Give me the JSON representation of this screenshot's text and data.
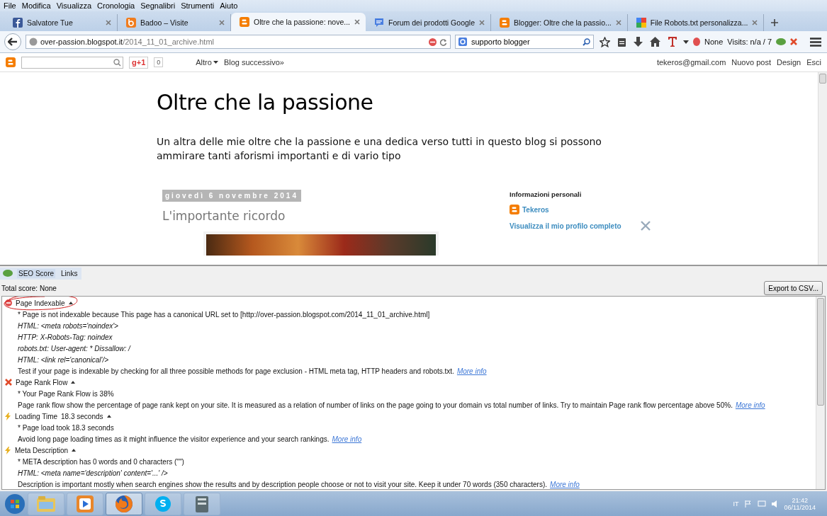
{
  "menu": [
    "File",
    "Modifica",
    "Visualizza",
    "Cronologia",
    "Segnalibri",
    "Strumenti",
    "Aiuto"
  ],
  "tabs": [
    {
      "title": "Salvatore Tue",
      "kind": "facebook",
      "selected": false
    },
    {
      "title": "Badoo – Visite",
      "kind": "badoo",
      "selected": false
    },
    {
      "title": "Oltre che la passione: nove...",
      "kind": "blogger",
      "selected": true
    },
    {
      "title": "Forum dei prodotti Google",
      "kind": "forum",
      "selected": false
    },
    {
      "title": "Blogger: Oltre che la passio...",
      "kind": "blogger",
      "selected": false
    },
    {
      "title": "File Robots.txt personalizza...",
      "kind": "google",
      "selected": false
    }
  ],
  "address": {
    "host": "over-passion.blogspot.it",
    "path": "/2014_11_01_archive.html"
  },
  "search": {
    "value": "supporto blogger"
  },
  "toolbar": {
    "seo_status": "None",
    "visits": "Visits: n/a / 7"
  },
  "blogger_bar": {
    "plus_one": "g+1",
    "count": "0",
    "more": "Altro",
    "next_blog": "Blog successivo»",
    "email": "tekeros@gmail.com",
    "links": [
      "Nuovo post",
      "Design",
      "Esci"
    ]
  },
  "blog": {
    "title": "Oltre che la passione",
    "description": "Un altra delle mie oltre che la passione e una dedica verso tutti in questo blog si possono ammirare tanti aforismi importanti e di vario tipo",
    "date": "giovedì 6 novembre 2014",
    "post_title": "L'importante ricordo",
    "sidebar_heading": "Informazioni personali",
    "profile_name": "Tekeros",
    "profile_link": "Visualizza il mio profilo completo"
  },
  "seo_panel": {
    "tabs": [
      {
        "label": "SEO Score",
        "selected": true
      },
      {
        "label": "Links",
        "selected": false
      }
    ],
    "total": "Total score: None",
    "export": "Export to CSV...",
    "items": [
      {
        "kind": "error",
        "title": "Page Indexable",
        "value": "",
        "circled": true,
        "lines": [
          {
            "text": "* Page is not indexable because This page has a canonical URL set to [http://over-passion.blogspot.com/2014_11_01_archive.html]",
            "italic": false
          },
          {
            "text": "HTML: <meta robots='noindex'>",
            "italic": true
          },
          {
            "text": "HTTP: X-Robots-Tag: noindex",
            "italic": true
          },
          {
            "text": "robots.txt: User-agent: * Dissallow: /",
            "italic": true
          },
          {
            "text": "HTML: <link rel='canonical'/>",
            "italic": true
          }
        ],
        "description": "Test if your page is indexable by checking for all three possible methods for page exclusion - HTML meta tag, HTTP headers and robots.txt.",
        "link": "More info"
      },
      {
        "kind": "fail",
        "title": "Page Rank Flow",
        "value": "",
        "circled": false,
        "lines": [
          {
            "text": "* Your Page Rank Flow is 38%",
            "italic": false
          }
        ],
        "description": "Page rank flow show the percentage of page rank kept on your site. It is measured as a relation of number of links on the page going to your domain vs total number of links. Try to maintain Page rank flow percentage above 50%.",
        "link": "More info"
      },
      {
        "kind": "warning",
        "title": "Loading Time",
        "value": "18.3 seconds",
        "circled": false,
        "lines": [
          {
            "text": "* Page load took 18.3 seconds",
            "italic": false
          }
        ],
        "description": "Avoid long page loading times as it might influence the visitor experience and your search rankings.",
        "link": "More info"
      },
      {
        "kind": "warning",
        "title": "Meta Description",
        "value": "",
        "circled": false,
        "lines": [
          {
            "text": "* META description has 0 words and 0 characters (\"\")",
            "italic": false
          },
          {
            "text": "HTML: <meta name='description' content='...' />",
            "italic": true
          }
        ],
        "description": "Description is important mostly when search engines show the results and by description people choose or not to visit your site. Keep it under 70 words (350 characters).",
        "link": "More info"
      }
    ]
  },
  "taskbar": {
    "apps": [
      {
        "kind": "explorer",
        "selected": false
      },
      {
        "kind": "media",
        "selected": false
      },
      {
        "kind": "firefox",
        "selected": true
      },
      {
        "kind": "skype",
        "selected": false
      },
      {
        "kind": "archive",
        "selected": false
      }
    ],
    "language": "IT",
    "time": "21:42",
    "date": "06/11/2014"
  }
}
